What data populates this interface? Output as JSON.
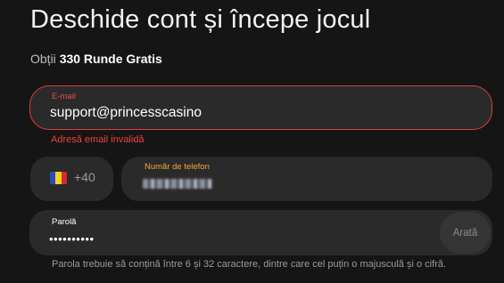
{
  "header": {
    "title": "Deschide cont și începe jocul",
    "subtitle_prefix": "Obții",
    "subtitle_bold": "330 Runde Gratis"
  },
  "email": {
    "label": "E-mail",
    "value": "support@princesscasino",
    "error": "Adresă email invalidă",
    "state_color": "#e23b3b"
  },
  "phone": {
    "country_flag": "romania-flag-icon",
    "flag_colors": [
      "#2b4bbf",
      "#f5d01c",
      "#d52b2b"
    ],
    "country_code": "+40",
    "label": "Număr de telefon"
  },
  "password": {
    "label": "Parolă",
    "value": "••••••••••",
    "show_label": "Arată",
    "hint": "Parola trebuie să conțină între 6 și 32 caractere, dintre care cel puțin o majusculă și o cifră."
  }
}
